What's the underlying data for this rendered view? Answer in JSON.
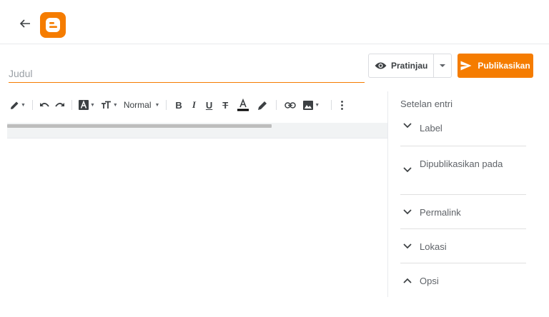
{
  "header": {
    "back_icon": "arrow-left-icon",
    "logo_icon": "blogger-logo-icon",
    "brand_color": "#f57c00"
  },
  "post": {
    "title_value": "",
    "title_placeholder": "Judul"
  },
  "actions": {
    "preview_label": "Pratinjau",
    "preview_icon": "eye-icon",
    "publish_label": "Publikasikan",
    "publish_icon": "send-icon"
  },
  "toolbar": {
    "paragraph_style": "Normal",
    "tools": [
      "pencil-icon",
      "undo-icon",
      "redo-icon",
      "font-icon",
      "text-size-icon",
      "bold-icon",
      "italic-icon",
      "underline-icon",
      "strikethrough-icon",
      "text-color-icon",
      "highlight-icon",
      "link-icon",
      "image-icon",
      "more-vert-icon"
    ],
    "text_color_bar": "#000000"
  },
  "sidebar": {
    "title": "Setelan entri",
    "sections": [
      {
        "label": "Label",
        "state": "collapsed"
      },
      {
        "label": "Dipublikasikan pada",
        "state": "collapsed"
      },
      {
        "label": "Permalink",
        "state": "collapsed"
      },
      {
        "label": "Lokasi",
        "state": "collapsed"
      },
      {
        "label": "Opsi",
        "state": "expanded"
      }
    ]
  }
}
